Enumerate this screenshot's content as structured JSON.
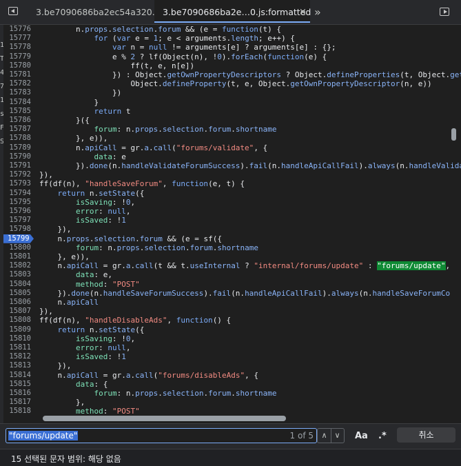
{
  "tabs": [
    {
      "label": "3.be7090686ba2ec54a320.js",
      "active": false
    },
    {
      "label": "3.be7090686ba2e…0.js:formatted",
      "active": true
    }
  ],
  "tab_close_glyph": "×",
  "more_tabs_glyph": "»",
  "edge_glyphs": [
    "17",
    "T",
    "4",
    "7",
    "1",
    "s",
    "F",
    "S"
  ],
  "lines": [
    {
      "n": "15776",
      "html": "        n.<span class=\"pr\">props</span>.<span class=\"pr\">selection</span>.<span class=\"pr\">forum</span> &amp;&amp; (e = <span class=\"kw\">function</span>(t) {"
    },
    {
      "n": "15777",
      "html": "            <span class=\"kw\">for</span> (<span class=\"kw\">var</span> e = <span class=\"pr\">1</span>; e &lt; arguments.<span class=\"pr\">length</span>; e++) {"
    },
    {
      "n": "15778",
      "html": "                <span class=\"kw\">var</span> n = <span class=\"kw\">null</span> != arguments[e] ? arguments[e] : {};"
    },
    {
      "n": "15779",
      "html": "                e % <span class=\"pr\">2</span> ? lf(Object(n), !<span class=\"pr\">0</span>).<span class=\"pr\">forEach</span>(<span class=\"kw\">function</span>(e) {"
    },
    {
      "n": "15780",
      "html": "                    ff(t, e, n[e])"
    },
    {
      "n": "15781",
      "html": "                }) : Object.<span class=\"pr\">getOwnPropertyDescriptors</span> ? Object.<span class=\"pr\">defineProperties</span>(t, Object.<span class=\"pr\">getO</span>"
    },
    {
      "n": "15782",
      "html": "                    Object.<span class=\"pr\">defineProperty</span>(t, e, Object.<span class=\"pr\">getOwnPropertyDescriptor</span>(n, e))"
    },
    {
      "n": "15783",
      "html": "                })"
    },
    {
      "n": "15784",
      "html": "            }"
    },
    {
      "n": "15785",
      "html": "            <span class=\"kw\">return</span> t"
    },
    {
      "n": "15786",
      "html": "        }({"
    },
    {
      "n": "15787",
      "html": "            <span class=\"prop\">forum</span>: n.<span class=\"pr\">props</span>.<span class=\"pr\">selection</span>.<span class=\"pr\">forum</span>.<span class=\"pr\">shortname</span>"
    },
    {
      "n": "15788",
      "html": "        }, e)),"
    },
    {
      "n": "15789",
      "html": "        n.<span class=\"pr\">apiCall</span> = gr.<span class=\"pr\">a</span>.<span class=\"pr\">call</span>(<span class=\"st\">\"forums/validate\"</span>, {"
    },
    {
      "n": "15790",
      "html": "            <span class=\"prop\">data</span>: e"
    },
    {
      "n": "15791",
      "html": "        }).<span class=\"pr\">done</span>(n.<span class=\"pr\">handleValidateForumSuccess</span>).<span class=\"pr\">fail</span>(n.<span class=\"pr\">handleApiCallFail</span>).<span class=\"pr\">always</span>(n.<span class=\"pr\">handleValidat</span>"
    },
    {
      "n": "15792",
      "html": "}),"
    },
    {
      "n": "15793",
      "html": "ff(df(n), <span class=\"st\">\"handleSaveForum\"</span>, <span class=\"kw\">function</span>(e, t) {"
    },
    {
      "n": "15794",
      "html": "    <span class=\"kw\">return</span> n.<span class=\"pr\">setState</span>({"
    },
    {
      "n": "15795",
      "html": "        <span class=\"prop\">isSaving</span>: !<span class=\"pr\">0</span>,"
    },
    {
      "n": "15796",
      "html": "        <span class=\"prop\">error</span>: <span class=\"kw\">null</span>,"
    },
    {
      "n": "15797",
      "html": "        <span class=\"prop\">isSaved</span>: !<span class=\"pr\">1</span>"
    },
    {
      "n": "15798",
      "html": "    }),"
    },
    {
      "n": "15799",
      "html": "    n.<span class=\"pr\">props</span>.<span class=\"pr\">selection</span>.<span class=\"pr\">forum</span> &amp;&amp; (e = sf({",
      "bp": true
    },
    {
      "n": "15800",
      "html": "        <span class=\"prop\">forum</span>: n.<span class=\"pr\">props</span>.<span class=\"pr\">selection</span>.<span class=\"pr\">forum</span>.<span class=\"pr\">shortname</span>"
    },
    {
      "n": "15801",
      "html": "    }, e)),"
    },
    {
      "n": "15802",
      "html": "    n.<span class=\"pr\">apiCall</span> = gr.<span class=\"pr\">a</span>.<span class=\"pr\">call</span>(t &amp;&amp; t.<span class=\"pr\">useInternal</span> ? <span class=\"st\">\"internal/forums/update\"</span> : <span class=\"hit\">\"forums/update\"</span>,"
    },
    {
      "n": "15803",
      "html": "        <span class=\"prop\">data</span>: e,"
    },
    {
      "n": "15804",
      "html": "        <span class=\"prop\">method</span>: <span class=\"st\">\"POST\"</span>"
    },
    {
      "n": "15805",
      "html": "    }).<span class=\"pr\">done</span>(n.<span class=\"pr\">handleSaveForumSuccess</span>).<span class=\"pr\">fail</span>(n.<span class=\"pr\">handleApiCallFail</span>).<span class=\"pr\">always</span>(n.<span class=\"pr\">handleSaveForumCo</span>"
    },
    {
      "n": "15806",
      "html": "    n.<span class=\"pr\">apiCall</span>"
    },
    {
      "n": "15807",
      "html": "}),"
    },
    {
      "n": "15808",
      "html": "ff(df(n), <span class=\"st\">\"handleDisableAds\"</span>, <span class=\"kw\">function</span>() {"
    },
    {
      "n": "15809",
      "html": "    <span class=\"kw\">return</span> n.<span class=\"pr\">setState</span>({"
    },
    {
      "n": "15810",
      "html": "        <span class=\"prop\">isSaving</span>: !<span class=\"pr\">0</span>,"
    },
    {
      "n": "15811",
      "html": "        <span class=\"prop\">error</span>: <span class=\"kw\">null</span>,"
    },
    {
      "n": "15812",
      "html": "        <span class=\"prop\">isSaved</span>: !<span class=\"pr\">1</span>"
    },
    {
      "n": "15813",
      "html": "    }),"
    },
    {
      "n": "15814",
      "html": "    n.<span class=\"pr\">apiCall</span> = gr.<span class=\"pr\">a</span>.<span class=\"pr\">call</span>(<span class=\"st\">\"forums/disableAds\"</span>, {"
    },
    {
      "n": "15815",
      "html": "        <span class=\"prop\">data</span>: {"
    },
    {
      "n": "15816",
      "html": "            <span class=\"prop\">forum</span>: n.<span class=\"pr\">props</span>.<span class=\"pr\">selection</span>.<span class=\"pr\">forum</span>.<span class=\"pr\">shortname</span>"
    },
    {
      "n": "15817",
      "html": "        },"
    },
    {
      "n": "15818",
      "html": "        <span class=\"prop\">method</span>: <span class=\"st\">\"POST\"</span>"
    }
  ],
  "search": {
    "value": "\"forums/update\"",
    "match_count": "1 of 5",
    "prev_glyph": "∧",
    "next_glyph": "∨",
    "match_case_label": "Aa",
    "regex_label": ".*",
    "cancel_label": "취소"
  },
  "status": {
    "text": "15 선택된 문자    범위: 해당 없음"
  },
  "colors": {
    "accent": "#7cacf8",
    "breakpoint": "#3b6fd4",
    "match_highlight": "#0f8a34"
  }
}
